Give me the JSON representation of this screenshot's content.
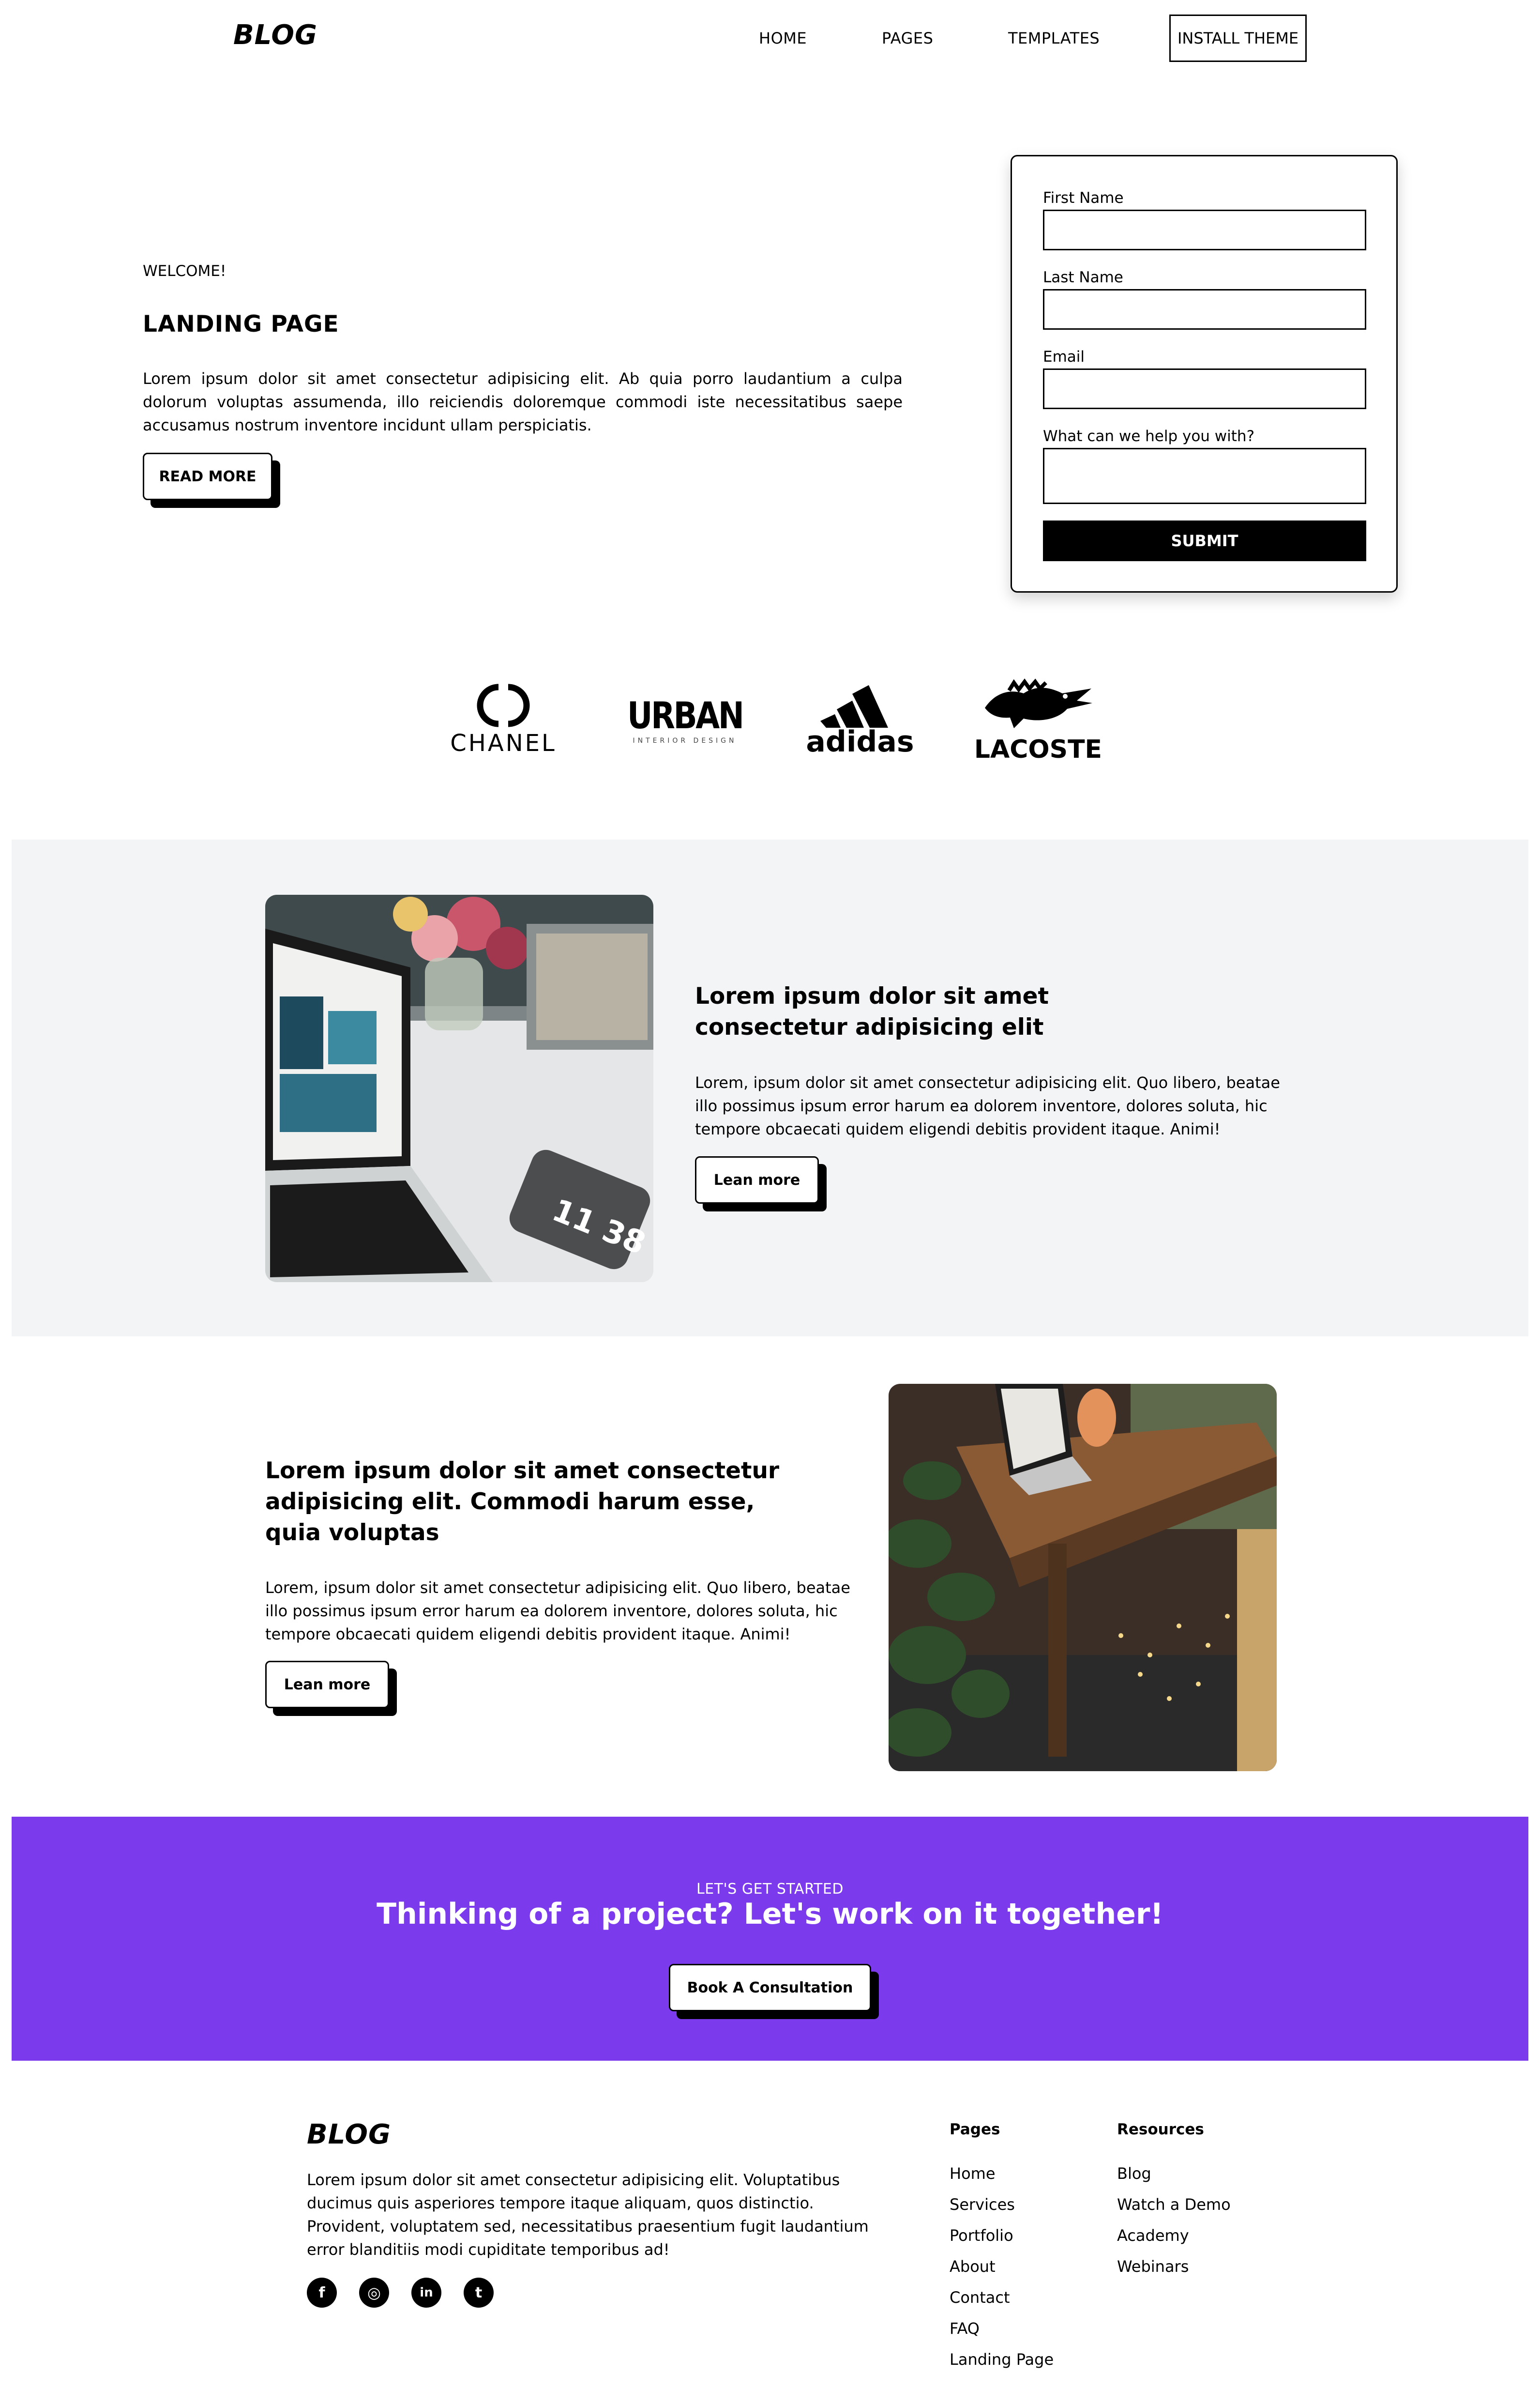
{
  "header": {
    "logo": "BLOG",
    "nav": [
      "HOME",
      "PAGES",
      "TEMPLATES"
    ],
    "cta": "INSTALL THEME"
  },
  "hero": {
    "kicker": "WELCOME!",
    "title": "LANDING PAGE",
    "text": "Lorem ipsum dolor sit amet consectetur adipisicing elit. Ab quia porro laudantium a culpa dolorum voluptas assumenda, illo reiciendis doloremque commodi iste necessitatibus saepe accusamus nostrum inventore incidunt ullam perspiciatis.",
    "button": "READ MORE"
  },
  "form": {
    "first_name_label": "First Name",
    "first_name_value": "",
    "last_name_label": "Last Name",
    "last_name_value": "",
    "email_label": "Email",
    "email_value": "",
    "help_label": "What can we help you with?",
    "help_value": "",
    "submit": "SUBMIT"
  },
  "brands": {
    "chanel": "CHANEL",
    "urban": "URBAN",
    "urban_sub": "INTERIOR DESIGN",
    "adidas": "adidas",
    "lacoste": "LACOSTE"
  },
  "feature1": {
    "title": "Lorem ipsum dolor sit amet consectetur adipisicing elit",
    "text": "Lorem, ipsum dolor sit amet consectetur adipisicing elit. Quo libero, beatae illo possimus ipsum error harum ea dolorem inventore, dolores soluta, hic tempore obcaecati quidem eligendi debitis provident itaque. Animi!",
    "button": "Lean more",
    "phone_time": "11 38"
  },
  "feature2": {
    "title": "Lorem ipsum dolor sit amet consectetur adipisicing elit. Commodi harum esse, quia voluptas",
    "text": "Lorem, ipsum dolor sit amet consectetur adipisicing elit. Quo libero, beatae illo possimus ipsum error harum ea dolorem inventore, dolores soluta, hic tempore obcaecati quidem eligendi debitis provident itaque. Animi!",
    "button": "Lean more"
  },
  "cta": {
    "kicker": "LET'S GET STARTED",
    "title": "Thinking of a project? Let's work on it together!",
    "button": "Book A Consultation"
  },
  "footer": {
    "logo": "BLOG",
    "text": "Lorem ipsum dolor sit amet consectetur adipisicing elit. Voluptatibus ducimus quis asperiores tempore itaque aliquam, quos distinctio. Provident, voluptatem sed, necessitatibus praesentium fugit laudantium error blanditiis modi cupiditate temporibus ad!",
    "pages_heading": "Pages",
    "pages": [
      "Home",
      "Services",
      "Portfolio",
      "About",
      "Contact",
      "FAQ",
      "Landing Page"
    ],
    "resources_heading": "Resources",
    "resources": [
      "Blog",
      "Watch a Demo",
      "Academy",
      "Webinars"
    ],
    "social_icons": [
      "facebook-icon",
      "instagram-icon",
      "linkedin-icon",
      "twitter-icon"
    ],
    "social_glyphs": [
      "f",
      "◎",
      "in",
      "t"
    ]
  },
  "colors": {
    "accent": "#7c3aed",
    "band": "#f3f4f6",
    "text": "#000000"
  }
}
